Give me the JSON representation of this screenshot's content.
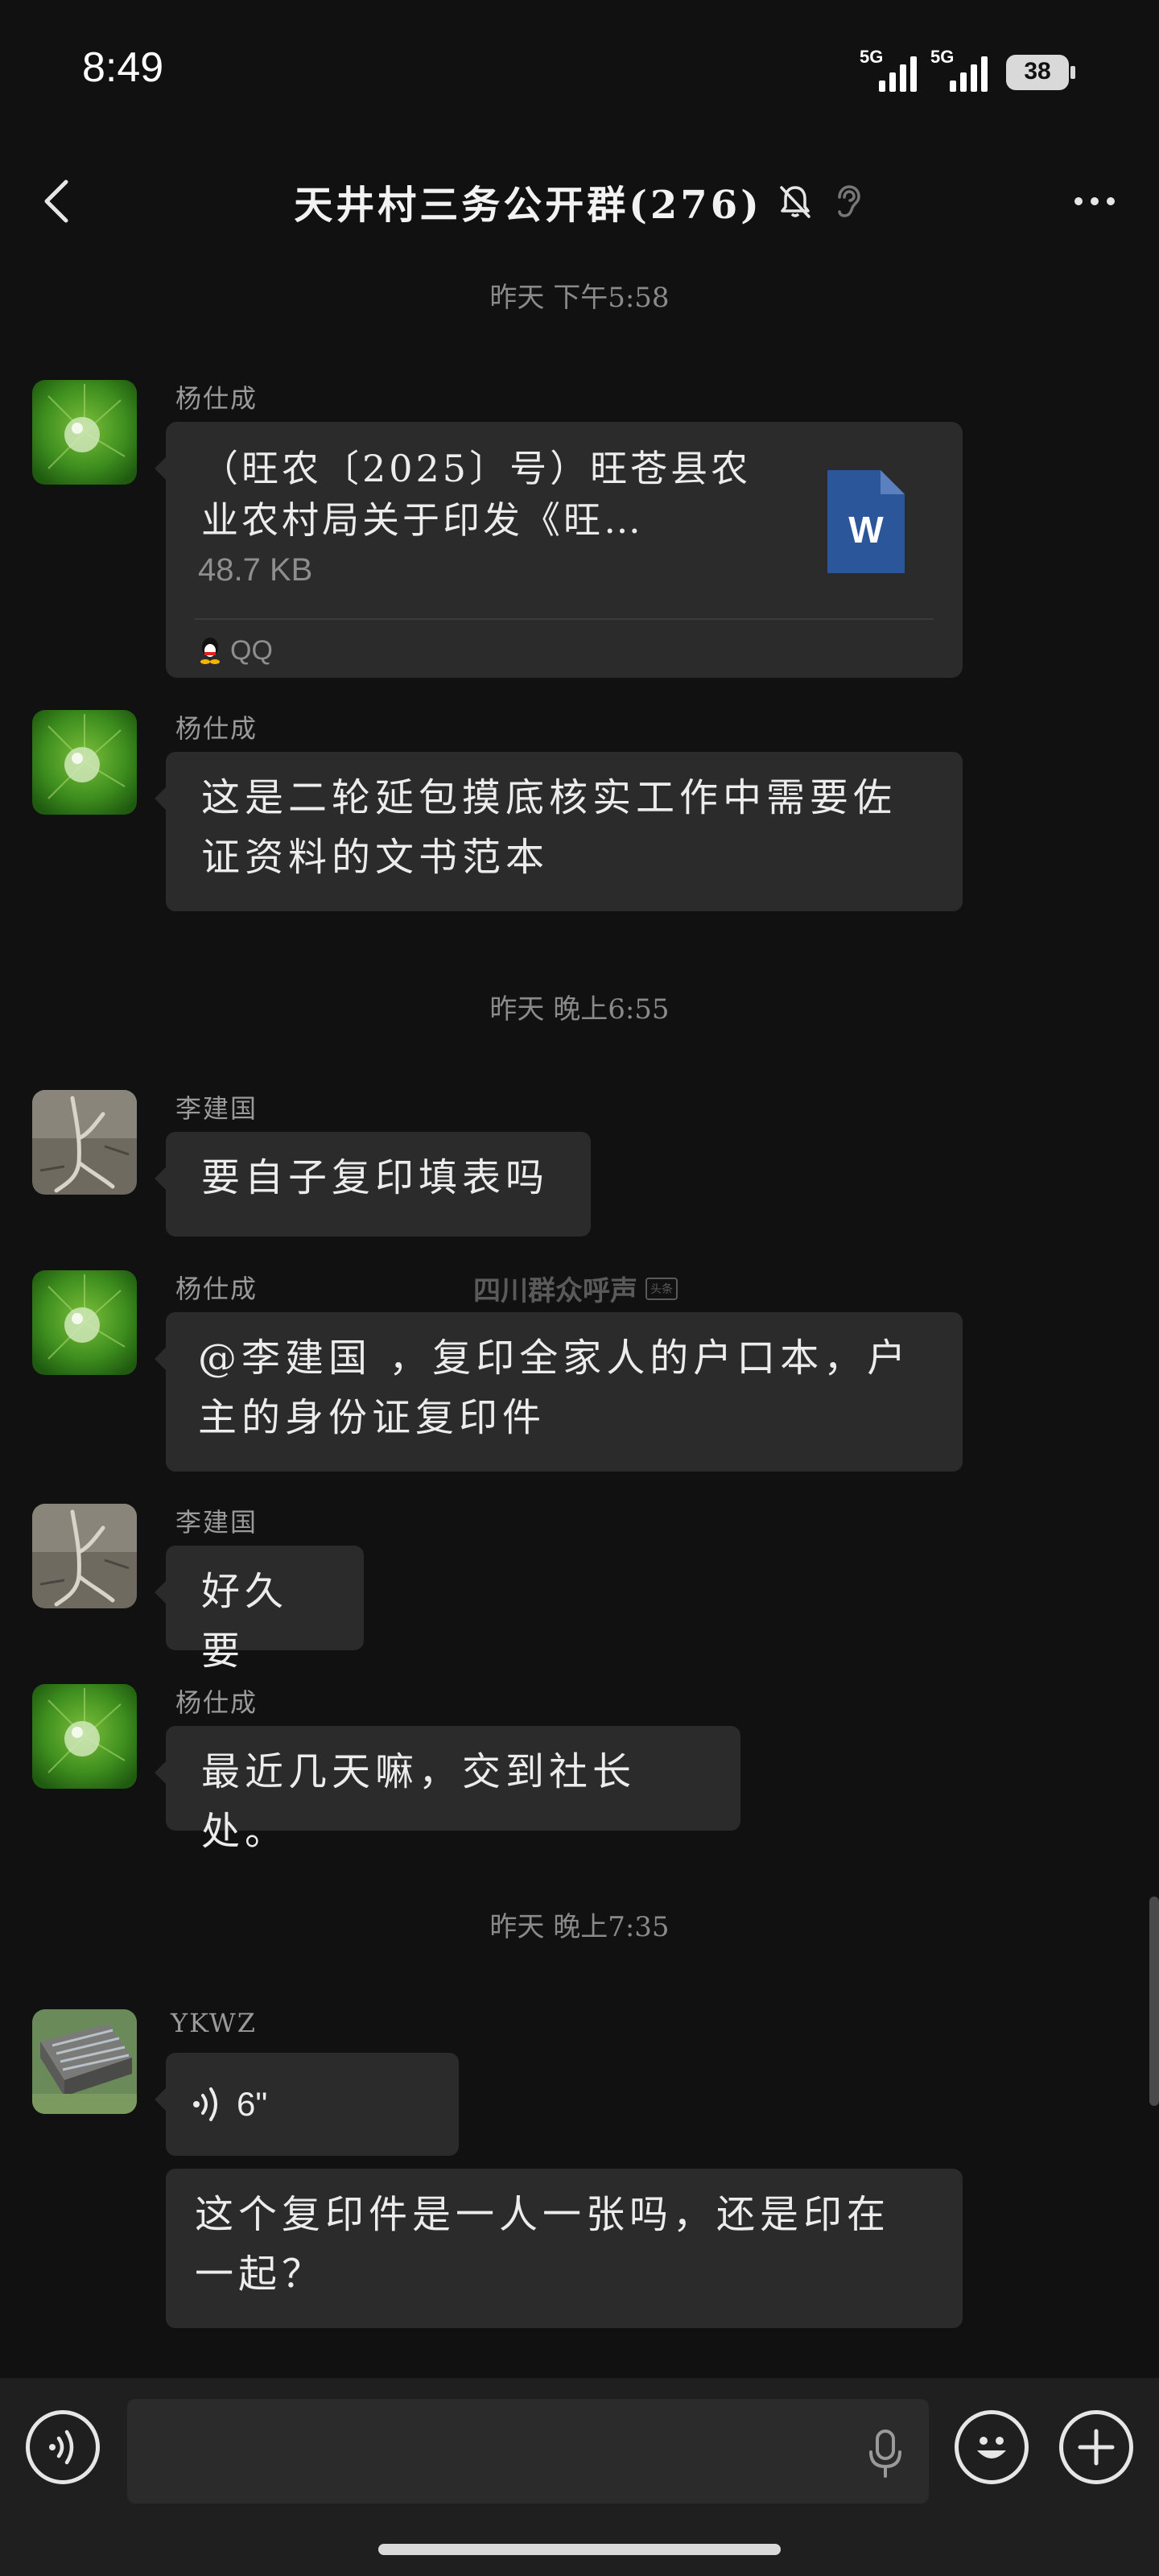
{
  "status_bar": {
    "time": "8:49",
    "signal1_label": "5G",
    "signal2_label": "5G",
    "battery": "38"
  },
  "nav": {
    "title": "天井村三务公开群(276)",
    "icons": [
      "back-icon",
      "bell-muted-icon",
      "ear-icon",
      "more-icon"
    ]
  },
  "messages": {
    "ts1": "昨天  下午5:58",
    "ts2": "昨天  晚上6:55",
    "ts3": "昨天  晚上7:35",
    "m1": {
      "sender": "杨仕成",
      "file_name": "（旺农〔2025〕号）旺苍县农业农村局关于印发《旺…",
      "file_size": "48.7  KB",
      "file_source": "QQ"
    },
    "m2": {
      "sender": "杨仕成",
      "text": "这是二轮延包摸底核实工作中需要佐证资料的文书范本"
    },
    "m3": {
      "sender": "李建国",
      "text": "要自子复印填表吗"
    },
    "m4": {
      "sender": "杨仕成",
      "text": "@李建国 ，复印全家人的户口本，户主的身份证复印件"
    },
    "m5": {
      "sender": "李建国",
      "text": "好久要"
    },
    "m6": {
      "sender": "杨仕成",
      "text": "最近几天嘛，交到社长处。"
    },
    "m7": {
      "sender": "YKWZ",
      "voice_duration": "6\"",
      "text": "这个复印件是一人一张吗，还是印在一起？"
    }
  },
  "watermark": {
    "text": "四川群众呼声",
    "tag": "头条"
  },
  "input": {
    "placeholder": ""
  },
  "colors": {
    "background": "#111111",
    "bubble": "#2b2b2b",
    "word_blue": "#2b5699"
  }
}
